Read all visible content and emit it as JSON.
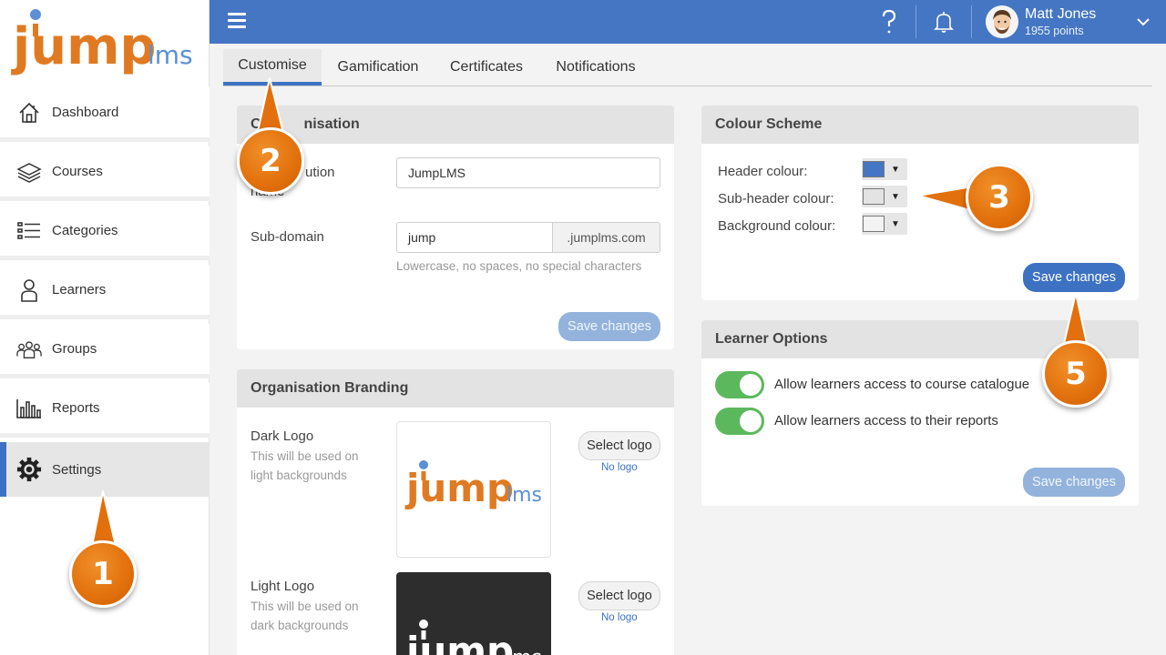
{
  "app": {
    "logo_text": "jump",
    "logo_suffix": "lms"
  },
  "sidebar": {
    "items": [
      {
        "label": "Dashboard",
        "icon": "home-icon"
      },
      {
        "label": "Courses",
        "icon": "courses-stack-icon"
      },
      {
        "label": "Categories",
        "icon": "list-icon"
      },
      {
        "label": "Learners",
        "icon": "user-icon"
      },
      {
        "label": "Groups",
        "icon": "group-icon"
      },
      {
        "label": "Reports",
        "icon": "bar-chart-icon"
      },
      {
        "label": "Settings",
        "icon": "gear-icon"
      }
    ],
    "active": "Settings"
  },
  "header": {
    "user_name": "Matt Jones",
    "user_points": "1955 points",
    "bg_color": "#4576c4"
  },
  "tabs": {
    "items": [
      "Customise",
      "Gamification",
      "Certificates",
      "Notifications"
    ],
    "active": "Customise"
  },
  "organisation": {
    "title": "Organisation",
    "title_visible": "O",
    "title_tail": "nisation",
    "name_label_line1_tail": "ution",
    "name_label_line2": "name",
    "name_value": "JumpLMS",
    "subdomain_label": "Sub-domain",
    "subdomain_value": "jump",
    "subdomain_suffix": ".jumplms.com",
    "subdomain_hint": "Lowercase, no spaces, no special characters",
    "save_label": "Save changes"
  },
  "branding": {
    "title": "Organisation Branding",
    "dark_logo_label": "Dark Logo",
    "dark_logo_hint1": "This will be used on",
    "dark_logo_hint2": "light backgrounds",
    "light_logo_label": "Light Logo",
    "light_logo_hint1": "This will be used on",
    "light_logo_hint2": "dark backgrounds",
    "select_label": "Select logo",
    "no_logo": "No logo"
  },
  "colour_scheme": {
    "title": "Colour Scheme",
    "header_label": "Header colour:",
    "header_color": "#4576c4",
    "subheader_label": "Sub-header colour:",
    "subheader_color": "#e3e3e3",
    "background_label": "Background colour:",
    "background_color": "#f3f3f3",
    "save_label": "Save changes"
  },
  "learner_options": {
    "title": "Learner Options",
    "option1": "Allow learners access to course catalogue",
    "option1_on": true,
    "option2": "Allow learners access to their reports",
    "option2_on": true,
    "save_label": "Save changes"
  },
  "callouts": {
    "one": "1",
    "two": "2",
    "three": "3",
    "five": "5"
  },
  "colors": {
    "accent": "#3d72c2",
    "callout": "#e2700c",
    "toggle_on": "#5cb85c"
  }
}
